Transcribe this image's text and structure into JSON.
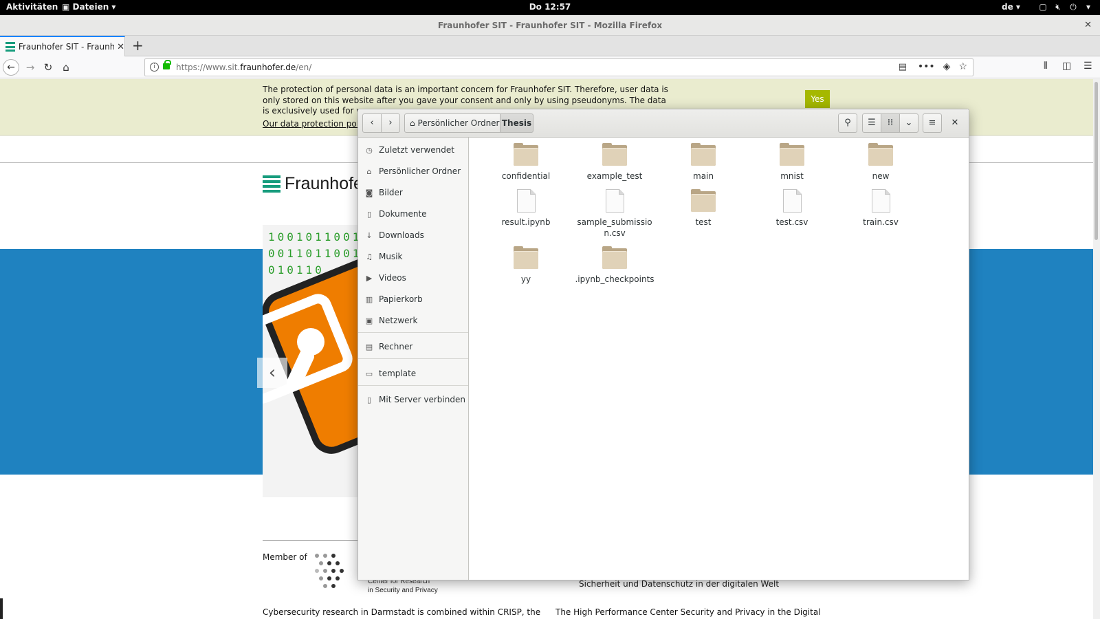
{
  "topbar": {
    "activities": "Aktivitäten",
    "app_menu": "Dateien ▾",
    "clock": "Do 12:57",
    "lang": "de ▾",
    "tray_icons": [
      "window-icon",
      "volume-muted-icon",
      "power-icon"
    ]
  },
  "browser": {
    "window_title": "Fraunhofer SIT - Fraunhofer SIT - Mozilla Firefox",
    "tab_title": "Fraunhofer SIT - Fraunhofer SIT",
    "url_prefix": "https://www.sit.",
    "url_domain": "fraunhofer.de",
    "url_path": "/en/"
  },
  "page": {
    "cookie_text": "The protection of personal data is an important concern for Fraunhofer SIT. Therefore, user data is only stored on this website after you gave your consent and only by using pseudonyms. The data is exclusively used for we",
    "cookie_link": "Our data protection pol",
    "yes_label": "Yes",
    "logo_text": "Fraunhofe",
    "carousel_prev": "‹",
    "member_of": "Member of",
    "crisp_line1": "Center for Research",
    "crisp_line2": "in Security and Privacy",
    "footer_mid": "Sicherheit und Datenschutz in der digitalen Welt",
    "footer_text_a": "Cybersecurity research in Darmstadt is combined within CRISP, the",
    "footer_text_b": "The High Performance Center Security and Privacy in the Digital"
  },
  "dialog": {
    "breadcrumb_home": "Persönlicher Ordner",
    "breadcrumb_current": "Thesis",
    "sidebar": [
      {
        "icon": "clock-icon",
        "glyph": "◷",
        "label": "Zuletzt verwendet"
      },
      {
        "icon": "home-icon",
        "glyph": "⌂",
        "label": "Persönlicher Ordner"
      },
      {
        "icon": "camera-icon",
        "glyph": "◙",
        "label": "Bilder"
      },
      {
        "icon": "document-icon",
        "glyph": "▯",
        "label": "Dokumente"
      },
      {
        "icon": "download-icon",
        "glyph": "↓",
        "label": "Downloads"
      },
      {
        "icon": "music-icon",
        "glyph": "♫",
        "label": "Musik"
      },
      {
        "icon": "video-icon",
        "glyph": "▶",
        "label": "Videos"
      },
      {
        "icon": "trash-icon",
        "glyph": "▥",
        "label": "Papierkorb"
      },
      {
        "icon": "network-icon",
        "glyph": "▣",
        "label": "Netzwerk"
      },
      {
        "icon": "computer-icon",
        "glyph": "▤",
        "label": "Rechner"
      },
      {
        "icon": "folder-icon",
        "glyph": "▭",
        "label": "template"
      },
      {
        "icon": "server-icon",
        "glyph": "▯",
        "label": "Mit Server verbinden"
      }
    ],
    "files": [
      {
        "name": "confidential",
        "type": "folder"
      },
      {
        "name": "example_test",
        "type": "folder"
      },
      {
        "name": "main",
        "type": "folder"
      },
      {
        "name": "mnist",
        "type": "folder"
      },
      {
        "name": "new",
        "type": "folder"
      },
      {
        "name": "result.ipynb",
        "type": "file"
      },
      {
        "name": "sample_submission.csv",
        "type": "file"
      },
      {
        "name": "test",
        "type": "folder"
      },
      {
        "name": "test.csv",
        "type": "file"
      },
      {
        "name": "train.csv",
        "type": "file"
      },
      {
        "name": "yy",
        "type": "folder"
      },
      {
        "name": ".ipynb_checkpoints",
        "type": "folder"
      }
    ]
  },
  "colors": {
    "cookie_bg": "#eaeccf",
    "yes_button": "#a5b800",
    "brand_blue": "#1f82c0",
    "fraunhofer_green": "#179c7d"
  }
}
